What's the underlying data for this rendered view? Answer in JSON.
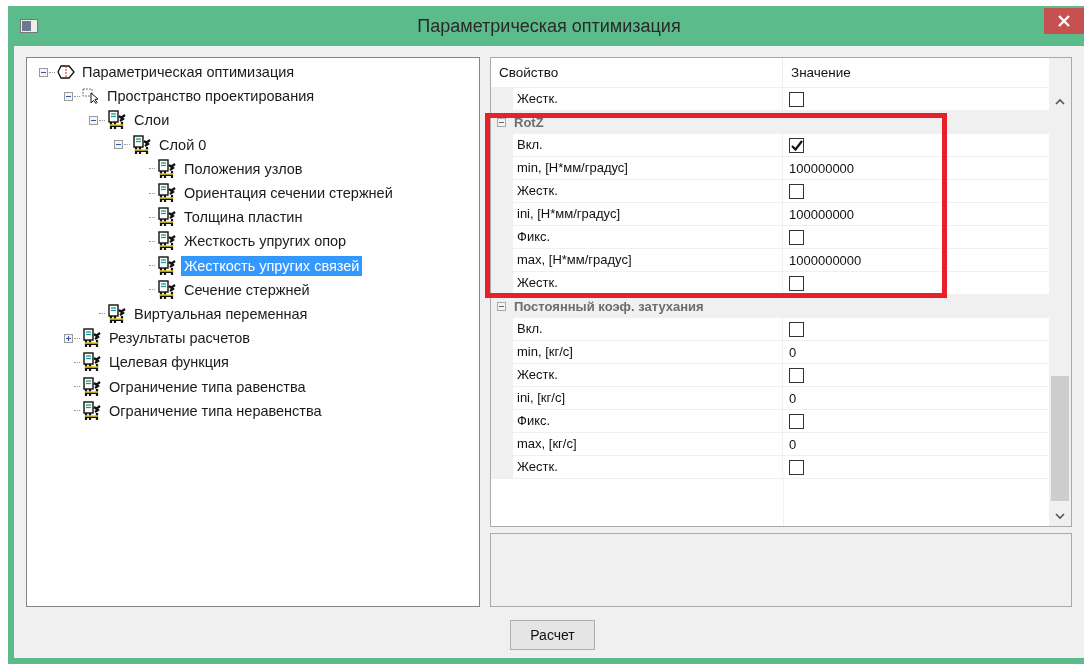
{
  "window": {
    "title": "Параметрическая оптимизация"
  },
  "tree": [
    {
      "label": "Параметрическая оптимизация",
      "kind": "goal",
      "expanded": true,
      "selected": false,
      "children": [
        {
          "label": "Пространство проектирования",
          "kind": "space",
          "expanded": true,
          "selected": false,
          "children": [
            {
              "label": "Слои",
              "kind": "item",
              "expanded": true,
              "selected": false,
              "children": [
                {
                  "label": "Слой 0",
                  "kind": "item",
                  "expanded": true,
                  "selected": false,
                  "children": [
                    {
                      "label": "Положения узлов",
                      "kind": "item",
                      "selected": false
                    },
                    {
                      "label": "Ориентация сечении стержней",
                      "kind": "item",
                      "selected": false
                    },
                    {
                      "label": "Толщина пластин",
                      "kind": "item",
                      "selected": false
                    },
                    {
                      "label": "Жесткость упругих опор",
                      "kind": "item",
                      "selected": false
                    },
                    {
                      "label": "Жесткость упругих связей",
                      "kind": "item",
                      "selected": true
                    },
                    {
                      "label": "Сечение стержней",
                      "kind": "item",
                      "selected": false
                    }
                  ]
                }
              ]
            },
            {
              "label": "Виртуальная переменная",
              "kind": "item",
              "selected": false
            }
          ]
        },
        {
          "label": "Результаты расчетов",
          "kind": "item",
          "expanded": false,
          "selected": false
        },
        {
          "label": "Целевая функция",
          "kind": "item",
          "selected": false
        },
        {
          "label": "Ограничение типа равенства",
          "kind": "item",
          "selected": false
        },
        {
          "label": "Ограничение типа неравенства",
          "kind": "item",
          "selected": false
        }
      ]
    }
  ],
  "property_grid": {
    "columns": [
      "Свойство",
      "Значение"
    ],
    "rows": [
      {
        "kind": "checkbox",
        "name": "Жестк.",
        "checked": false
      },
      {
        "kind": "category",
        "name": "RotZ",
        "expanded": true
      },
      {
        "kind": "checkbox",
        "name": "Вкл.",
        "checked": true
      },
      {
        "kind": "text",
        "name": "min, [Н*мм/градус]",
        "value": "100000000"
      },
      {
        "kind": "checkbox",
        "name": "Жестк.",
        "checked": false
      },
      {
        "kind": "text",
        "name": "ini, [Н*мм/градус]",
        "value": "100000000"
      },
      {
        "kind": "checkbox",
        "name": "Фикс.",
        "checked": false
      },
      {
        "kind": "text",
        "name": "max, [Н*мм/градус]",
        "value": "1000000000"
      },
      {
        "kind": "checkbox",
        "name": "Жестк.",
        "checked": false
      },
      {
        "kind": "category",
        "name": "Постоянный коэф. затухания",
        "expanded": true
      },
      {
        "kind": "checkbox",
        "name": "Вкл.",
        "checked": false
      },
      {
        "kind": "text",
        "name": "min, [кг/с]",
        "value": "0"
      },
      {
        "kind": "checkbox",
        "name": "Жестк.",
        "checked": false
      },
      {
        "kind": "text",
        "name": "ini, [кг/с]",
        "value": "0"
      },
      {
        "kind": "checkbox",
        "name": "Фикс.",
        "checked": false
      },
      {
        "kind": "text",
        "name": "max, [кг/с]",
        "value": "0"
      },
      {
        "kind": "checkbox",
        "name": "Жестк.",
        "checked": false
      }
    ]
  },
  "buttons": [
    {
      "label": "Расчет"
    }
  ]
}
